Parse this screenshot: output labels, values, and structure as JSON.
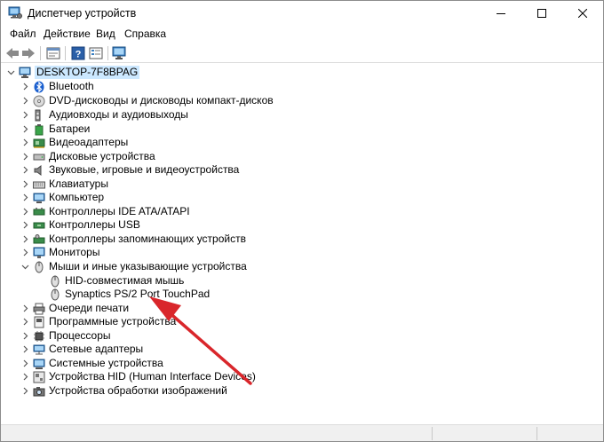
{
  "window": {
    "title": "Диспетчер устройств",
    "accent_color": "#cce8ff"
  },
  "menu": {
    "items": [
      "Файл",
      "Действие",
      "Вид",
      "Справка"
    ]
  },
  "toolbar": {
    "icons": [
      "back-arrow-icon",
      "forward-arrow-icon",
      "properties-icon",
      "help-icon",
      "view-list-icon",
      "monitor-icon"
    ]
  },
  "tree": {
    "root": "DESKTOP-7F8BPAG",
    "categories": [
      "Bluetooth",
      "DVD-дисководы и дисководы компакт-дисков",
      "Аудиовходы и аудиовыходы",
      "Батареи",
      "Видеоадаптеры",
      "Дисковые устройства",
      "Звуковые, игровые и видеоустройства",
      "Клавиатуры",
      "Компьютер",
      "Контроллеры IDE ATA/ATAPI",
      "Контроллеры USB",
      "Контроллеры запоминающих устройств",
      "Мониторы",
      "Мыши и иные указывающие устройства"
    ],
    "mouse_children": [
      "HID-совместимая мышь",
      "Synaptics PS/2 Port TouchPad"
    ],
    "categories_after": [
      "Очереди печати",
      "Программные устройства",
      "Процессоры",
      "Сетевые адаптеры",
      "Системные устройства",
      "Устройства HID (Human Interface Devices)",
      "Устройства обработки изображений"
    ]
  },
  "annotation": {
    "arrow_color": "#d9262b"
  }
}
